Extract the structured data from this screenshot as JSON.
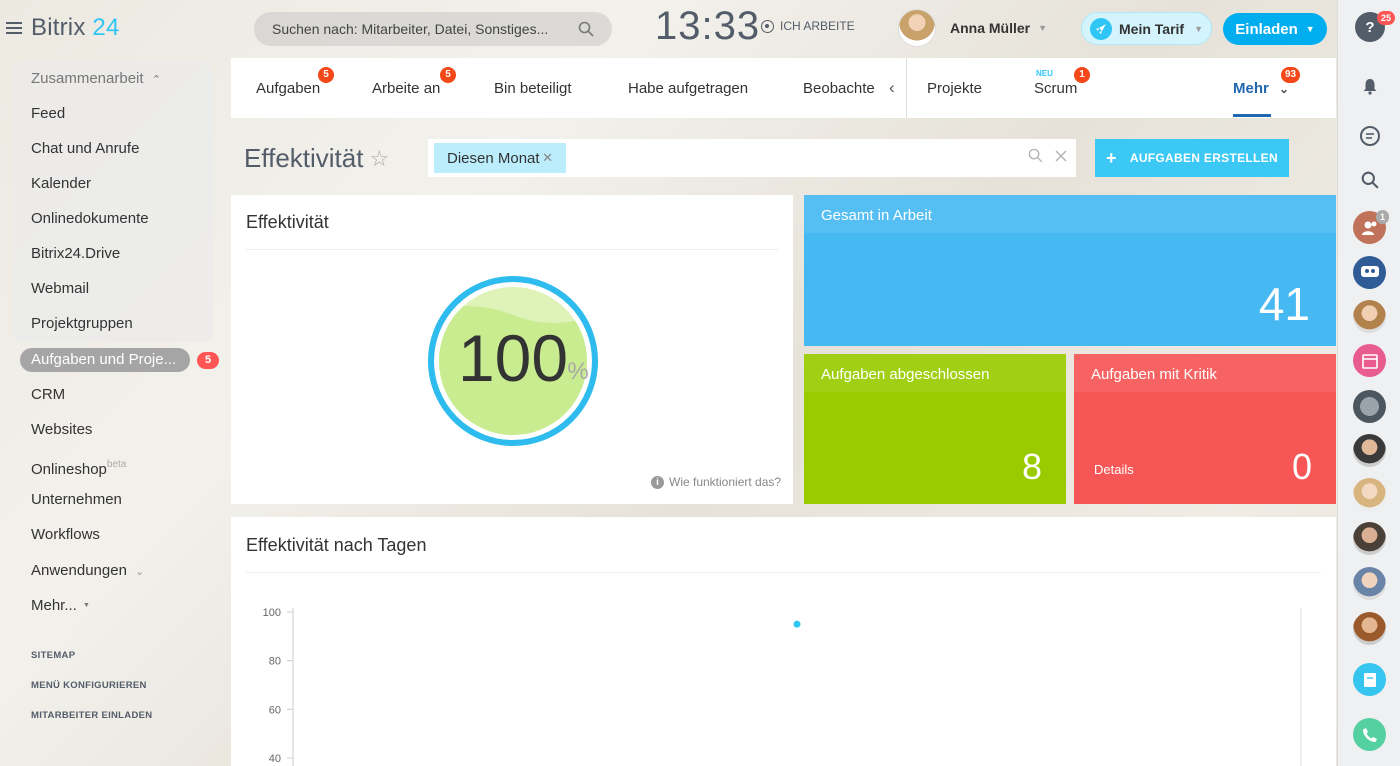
{
  "header": {
    "logo_main": "Bitrix",
    "logo_accent": "24",
    "search_placeholder": "Suchen nach: Mitarbeiter, Datei, Sonstiges...",
    "clock": "13:33",
    "work_status": "ICH ARBEITE",
    "user_name": "Anna Müller",
    "tarif_label": "Mein Tarif",
    "invite_label": "Einladen"
  },
  "sidebar": {
    "group_title": "Zusammenarbeit",
    "group_items": [
      "Feed",
      "Chat und Anrufe",
      "Kalender",
      "Onlinedokumente",
      "Bitrix24.Drive",
      "Webmail",
      "Projektgruppen"
    ],
    "active_item": "Aufgaben und Proje...",
    "active_badge": "5",
    "items": [
      "CRM",
      "Websites",
      "Onlineshop",
      "Unternehmen",
      "Workflows",
      "Anwendungen",
      "Mehr..."
    ],
    "onlineshop_sup": "beta",
    "footer_links": [
      "SITEMAP",
      "MENÜ KONFIGURIEREN",
      "MITARBEITER EINLADEN"
    ]
  },
  "tabs": {
    "items": [
      {
        "label": "Aufgaben",
        "badge": "5"
      },
      {
        "label": "Arbeite an",
        "badge": "5"
      },
      {
        "label": "Bin beteiligt",
        "badge": ""
      },
      {
        "label": "Habe aufgetragen",
        "badge": ""
      },
      {
        "label": "Beobachte",
        "badge": ""
      },
      {
        "label": "Projekte",
        "badge": ""
      },
      {
        "label": "Scrum",
        "badge": "1"
      },
      {
        "label": "Mehr",
        "badge": "93"
      }
    ],
    "scrum_tag": "NEU",
    "chevron": "‹"
  },
  "title_row": {
    "page_title": "Effektivität",
    "filter_chip": "Diesen Monat",
    "create_button": "AUFGABEN ERSTELLEN"
  },
  "effectiveness_card": {
    "title": "Effektivität",
    "value": "100",
    "unit": "%",
    "fill_fraction": 1.0,
    "help_text": "Wie funktioniert das?"
  },
  "tiles": {
    "in_progress": {
      "title": "Gesamt in Arbeit",
      "value": "41",
      "color": "#47b9f2"
    },
    "completed": {
      "title": "Aufgaben abgeschlossen",
      "value": "8",
      "color": "#9acb01"
    },
    "critical": {
      "title": "Aufgaben mit Kritik",
      "value": "0",
      "details": "Details",
      "color": "#f65655"
    }
  },
  "daily_card": {
    "title": "Effektivität nach Tagen"
  },
  "chart_data": {
    "type": "scatter",
    "title": "Effektivität nach Tagen",
    "xlabel": "",
    "ylabel": "",
    "ylim": [
      40,
      100
    ],
    "y_ticks": [
      100,
      80,
      60,
      40
    ],
    "points": [
      {
        "x": 0.5,
        "y": 95
      }
    ],
    "grid": false
  },
  "rail": {
    "help_badge": "25",
    "people_badge": "1"
  },
  "colors": {
    "accent": "#2fc6f6",
    "tab_active": "#2067b0",
    "badge": "#f54819"
  }
}
